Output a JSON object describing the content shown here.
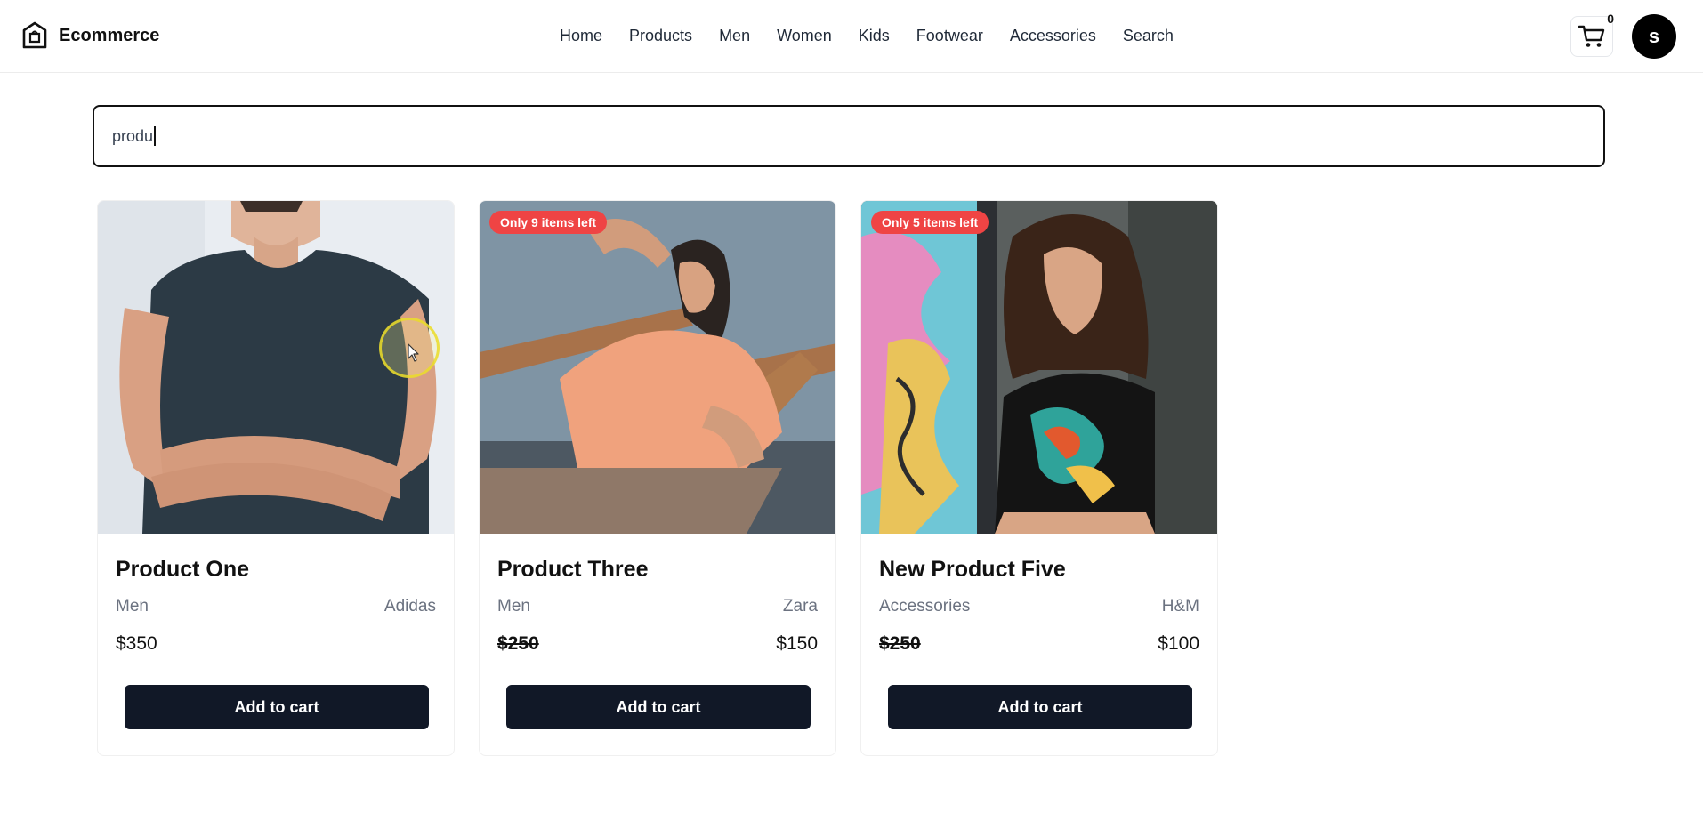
{
  "header": {
    "brand": "Ecommerce",
    "nav": [
      "Home",
      "Products",
      "Men",
      "Women",
      "Kids",
      "Footwear",
      "Accessories",
      "Search"
    ],
    "cart_count": "0",
    "avatar_initial": "s",
    "icons": {
      "brand": "home-bag-icon",
      "cart": "cart-icon"
    }
  },
  "search": {
    "value": "produ"
  },
  "products": [
    {
      "name": "Product One",
      "category": "Men",
      "brand": "Adidas",
      "price": "$350",
      "old_price": "",
      "badge": "",
      "image": "man-dark-tank-top-photo"
    },
    {
      "name": "Product Three",
      "category": "Men",
      "brand": "Zara",
      "price": "$150",
      "old_price": "$250",
      "badge": "Only 9 items left",
      "image": "man-orange-tshirt-photo"
    },
    {
      "name": "New Product Five",
      "category": "Accessories",
      "brand": "H&M",
      "price": "$100",
      "old_price": "$250",
      "badge": "Only 5 items left",
      "image": "woman-dragon-tshirt-photo"
    }
  ],
  "add_to_cart_label": "Add to cart",
  "colors": {
    "primary": "#111827",
    "badge": "#ef4444",
    "muted": "#6b7280"
  }
}
